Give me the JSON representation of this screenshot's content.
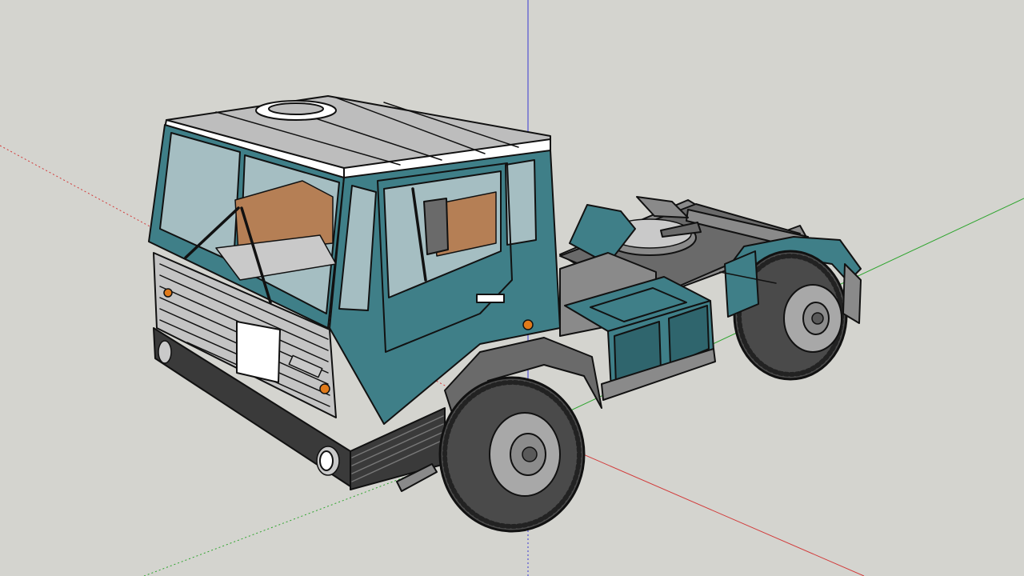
{
  "viewport": {
    "background": "#d4d4cf",
    "axis_colors": {
      "red": "#d23b3b",
      "green": "#2fa52f",
      "blue": "#3a3ad0"
    }
  },
  "model": {
    "icon": "truck-tractor-unit-model",
    "colors": {
      "body": "#3f7f88",
      "body_dark": "#2f656d",
      "roof": "#bdbdbd",
      "roof_stripe": "#ffffff",
      "glass": "#b7c9cc",
      "interior": "#b57f55",
      "grille": "#c4c4c4",
      "chassis": "#8a8a8a",
      "tire": "#4a4a4a",
      "rim": "#a8a8a8",
      "indicator": "#e07a1a",
      "outline": "#111111"
    }
  }
}
